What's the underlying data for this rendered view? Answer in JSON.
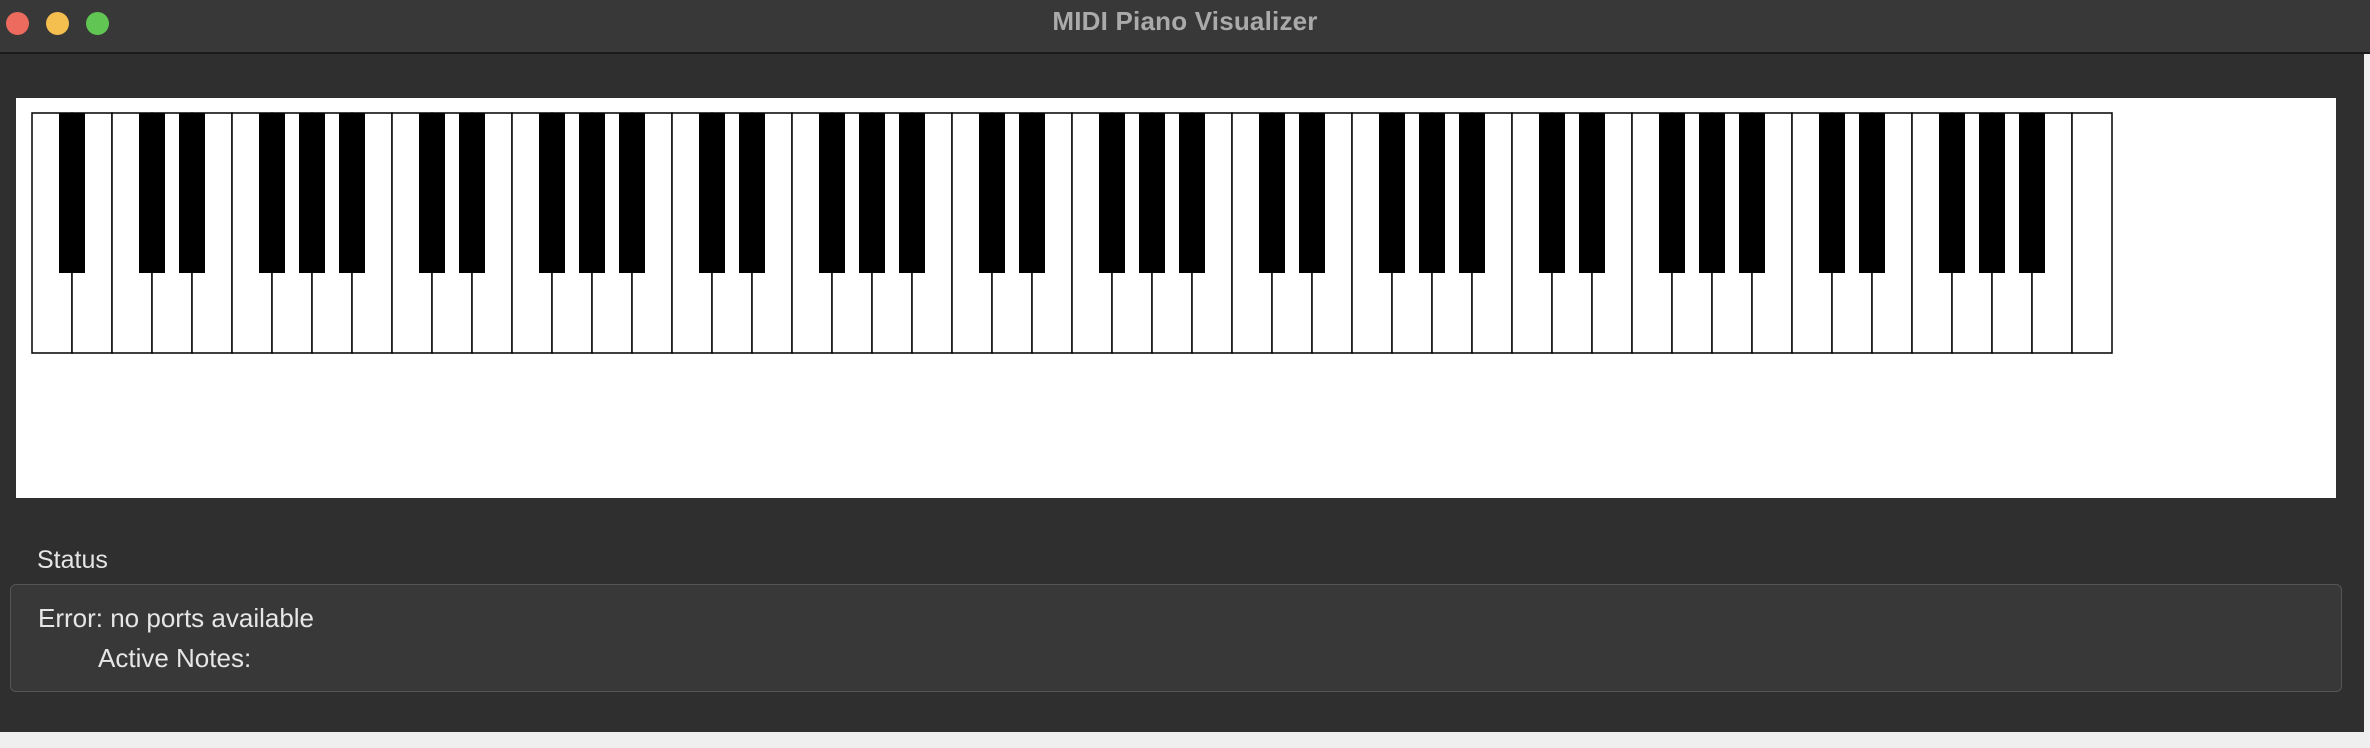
{
  "window": {
    "title": "MIDI Piano Visualizer"
  },
  "piano": {
    "start_note": "A0",
    "white_key_count": 52,
    "black_key_count": 36,
    "active_notes": [],
    "colors": {
      "white_key": "#ffffff",
      "black_key": "#000000",
      "key_border": "#000000"
    }
  },
  "status": {
    "label": "Status",
    "error_text": "Error: no ports available",
    "active_notes_label": "Active Notes:"
  },
  "colors": {
    "window_bg": "#2f2f2f",
    "titlebar_bg": "#383838",
    "status_box_bg": "#383838",
    "text": "#e6e6e6",
    "close": "#ed6a5e",
    "minimize": "#f4bf4f",
    "zoom": "#61c554"
  }
}
